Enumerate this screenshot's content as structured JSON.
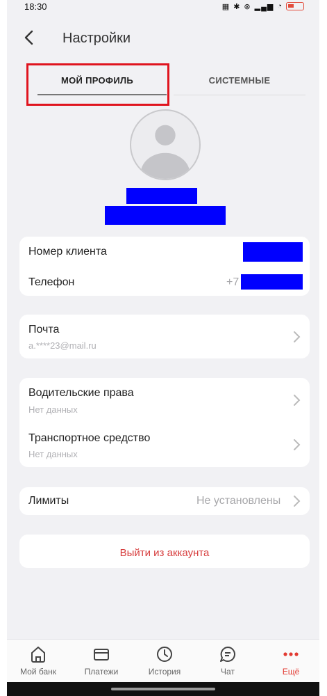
{
  "status_bar": {
    "time": "18:30",
    "icons": [
      "nfc-icon",
      "bluetooth-icon",
      "signal-icon",
      "wifi-icon",
      "battery-icon"
    ],
    "battery_color": "#e24b3b"
  },
  "header": {
    "title": "Настройки",
    "back_icon": "chevron-left-icon"
  },
  "tabs": [
    {
      "label": "МОЙ ПРОФИЛЬ",
      "active": true
    },
    {
      "label": "СИСТЕМНЫЕ",
      "active": false
    }
  ],
  "profile": {
    "avatar_icon": "user-avatar-icon"
  },
  "client_card": {
    "client_number_label": "Номер клиента",
    "phone_label": "Телефон",
    "phone_prefix": "+7"
  },
  "email_card": {
    "label": "Почта",
    "value": "a.****23@mail.ru"
  },
  "documents_card": {
    "license_label": "Водительские права",
    "license_value": "Нет данных",
    "vehicle_label": "Транспортное средство",
    "vehicle_value": "Нет данных"
  },
  "limits_card": {
    "label": "Лимиты",
    "value": "Не установлены"
  },
  "logout": {
    "label": "Выйти из аккаунта",
    "color": "#d63b3b"
  },
  "bottom_nav": [
    {
      "label": "Мой банк",
      "icon": "home-icon",
      "active": false
    },
    {
      "label": "Платежи",
      "icon": "wallet-icon",
      "active": false
    },
    {
      "label": "История",
      "icon": "clock-icon",
      "active": false
    },
    {
      "label": "Чат",
      "icon": "chat-icon",
      "active": false
    },
    {
      "label": "Ещё",
      "icon": "more-dots-icon",
      "active": true
    }
  ],
  "colors": {
    "accent": "#e23a32",
    "highlight_frame": "#e0141e",
    "redaction": "#0000ff",
    "background": "#f1f1f4"
  }
}
